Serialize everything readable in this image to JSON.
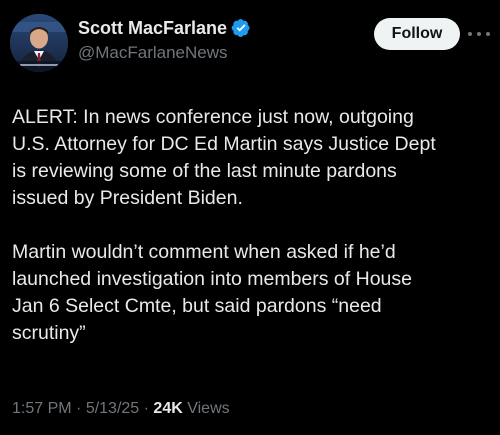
{
  "author": {
    "display_name": "Scott MacFarlane",
    "handle": "@MacFarlaneNews",
    "verified": true,
    "avatar_icon": "avatar-news-anchor"
  },
  "actions": {
    "follow_label": "Follow",
    "more_icon": "more-horizontal-icon"
  },
  "tweet": {
    "paragraphs": [
      "ALERT: In news conference just now, outgoing\nU.S. Attorney for DC Ed Martin says Justice Dept\nis reviewing some of the last minute pardons\nissued by President Biden.",
      "Martin wouldn’t comment when asked if he’d\nlaunched investigation into members of House\nJan 6 Select Cmte, but said pardons “need\nscrutiny”"
    ]
  },
  "meta": {
    "time": "1:57 PM",
    "separator": " · ",
    "date": "5/13/25",
    "views_count": "24K",
    "views_label": " Views"
  },
  "colors": {
    "background": "#000000",
    "text_primary": "#e7e9ea",
    "text_secondary": "#71767b",
    "verified_blue": "#1d9bf0",
    "follow_bg": "#eff3f4"
  }
}
